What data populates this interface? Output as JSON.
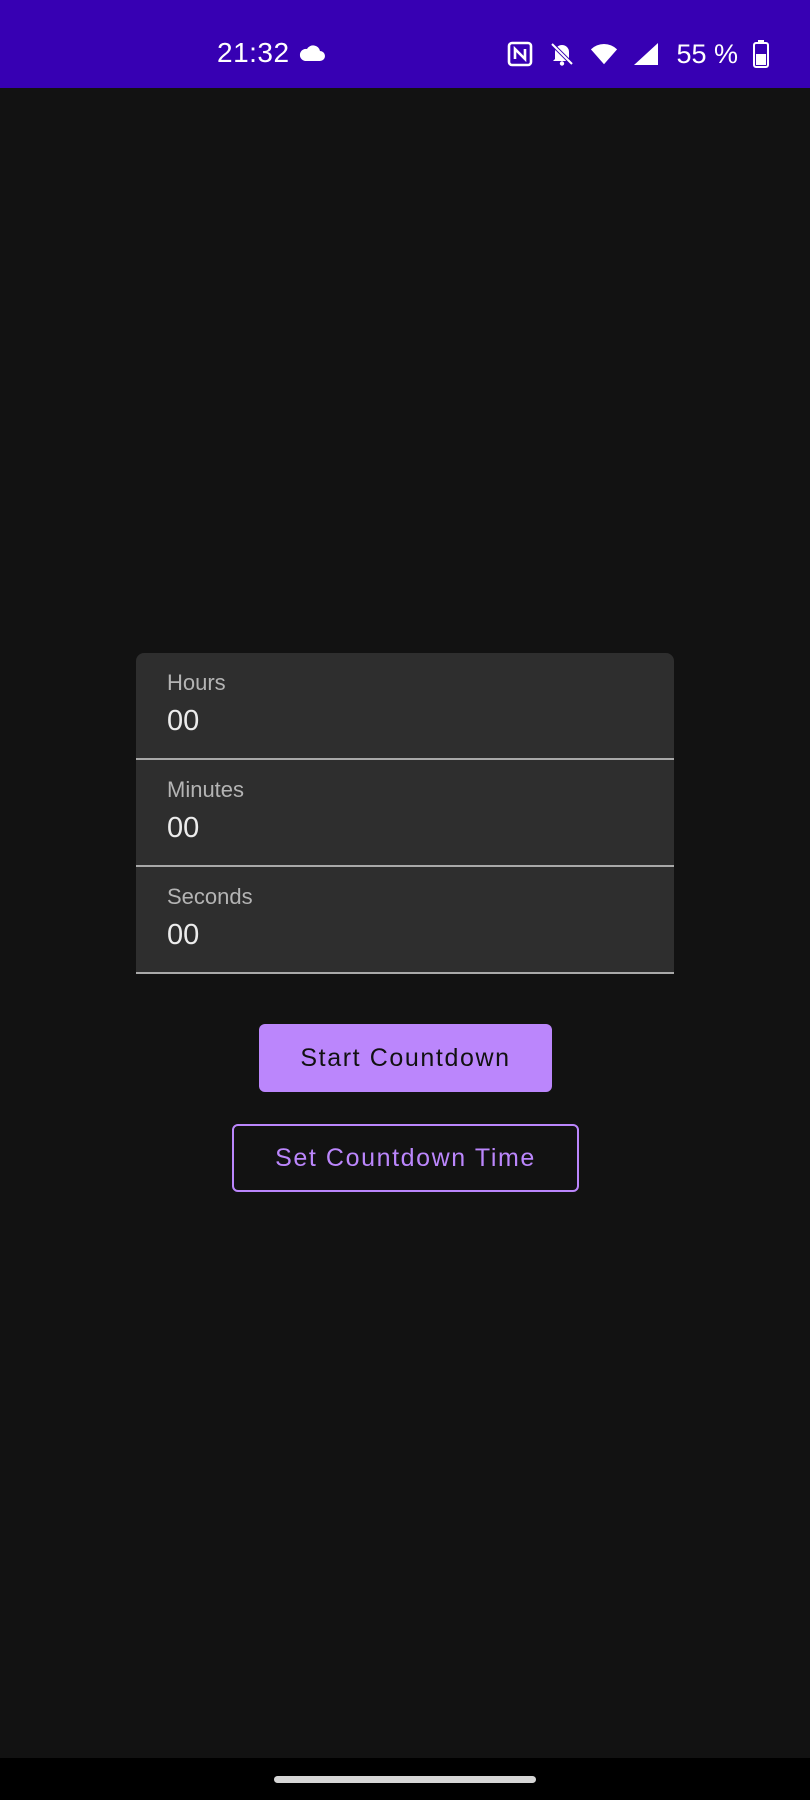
{
  "status_bar": {
    "time": "21:32",
    "battery_text": "55 %",
    "background_color": "#3700b3",
    "icons": [
      "cloud-icon",
      "nfc-icon",
      "bell-off-icon",
      "wifi-icon",
      "signal-icon",
      "battery-icon"
    ]
  },
  "form": {
    "fields": [
      {
        "label": "Hours",
        "value": "00"
      },
      {
        "label": "Minutes",
        "value": "00"
      },
      {
        "label": "Seconds",
        "value": "00"
      }
    ]
  },
  "buttons": {
    "start_label": "Start Countdown",
    "set_label": "Set Countdown Time"
  },
  "colors": {
    "accent": "#bb86fc",
    "background": "#121212",
    "field_background": "#2e2e2e"
  }
}
